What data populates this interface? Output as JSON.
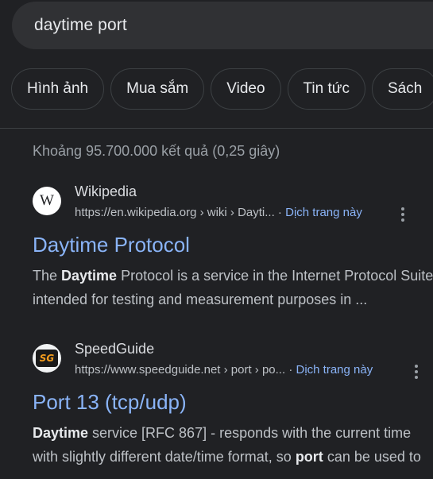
{
  "search": {
    "query": "daytime port"
  },
  "chips": [
    {
      "label": "Hình ảnh"
    },
    {
      "label": "Mua sắm"
    },
    {
      "label": "Video"
    },
    {
      "label": "Tin tức"
    },
    {
      "label": "Sách"
    }
  ],
  "stats": "Khoảng 95.700.000 kết quả (0,25 giây)",
  "results": [
    {
      "site_name": "Wikipedia",
      "favicon_letter": "W",
      "url": "https://en.wikipedia.org › wiki › Dayti...",
      "separator": " · ",
      "cached_label": "Dịch trang này",
      "title": "Daytime Protocol",
      "snippet_line1_bold": "Daytime",
      "snippet_line1_pre": "The ",
      "snippet_line1_post": " Protocol is a service in the Internet Protocol Suite",
      "snippet_line2": "intended for testing and measurement purposes in ..."
    },
    {
      "site_name": "SpeedGuide",
      "favicon_letter": "SG",
      "url": "https://www.speedguide.net › port › po...",
      "separator": " · ",
      "cached_label": "Dịch trang này",
      "title": "Port 13 (tcp/udp)",
      "snippet_line1_bold": "Daytime",
      "snippet_line1_post": " service [RFC 867] - responds with the current time",
      "snippet_line2_pre": "with slightly different date/time format, so ",
      "snippet_line2_bold": "port",
      "snippet_line2_post": " can be used to"
    }
  ],
  "icons": {
    "more": "three-dots-vertical-icon",
    "wiki_favicon": "wikipedia-icon",
    "sg_favicon": "speedguide-icon"
  }
}
